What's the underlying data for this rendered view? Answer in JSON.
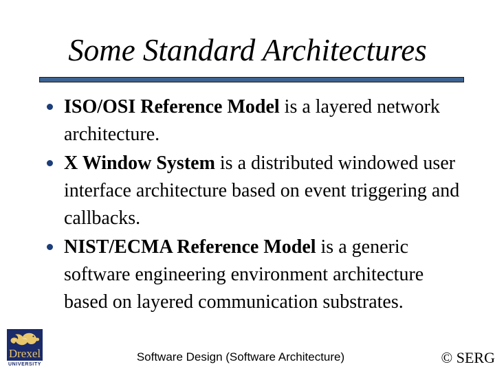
{
  "slide": {
    "title": "Some Standard Architectures",
    "background_color": "#ffffff",
    "divider_color": "#3d6391",
    "bullet_color": "#1b3d7a"
  },
  "body": {
    "bullets": [
      {
        "lead": "ISO/OSI Reference Model",
        "rest": " is a layered network architecture."
      },
      {
        "lead": "X Window System",
        "rest": " is a distributed windowed user interface architecture based on event triggering and callbacks."
      },
      {
        "lead": "NIST/ECMA Reference Model",
        "rest": " is a generic software engineering environment architecture based on layered communication substrates."
      }
    ]
  },
  "footer": {
    "center_text": "Software Design (Software Architecture)",
    "copyright": "© SERG"
  },
  "logo": {
    "wordmark": "Drexel",
    "subtext": "UNIVERSITY",
    "badge_color": "#1b2a68",
    "dragon_color": "#e8c66a"
  }
}
